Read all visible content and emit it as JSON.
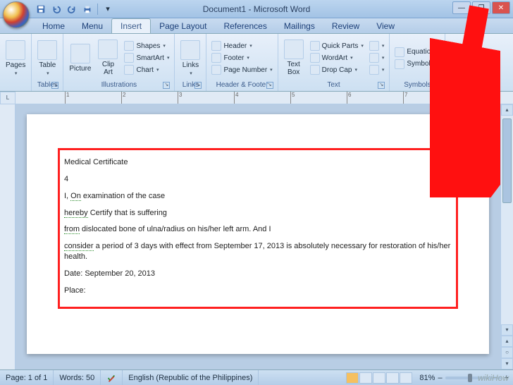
{
  "app": {
    "title": "Document1 - Microsoft Word"
  },
  "window_controls": {
    "minimize": "—",
    "maximize": "❐",
    "close": "✕"
  },
  "tabs": {
    "items": [
      "Home",
      "Menu",
      "Insert",
      "Page Layout",
      "References",
      "Mailings",
      "Review",
      "View"
    ],
    "active_index": 2
  },
  "ribbon": {
    "groups": [
      {
        "label": "",
        "large": [
          {
            "text": "Pages",
            "icon": "pages-icon"
          }
        ]
      },
      {
        "label": "Tables",
        "large": [
          {
            "text": "Table",
            "icon": "table-icon"
          }
        ]
      },
      {
        "label": "Illustrations",
        "large": [
          {
            "text": "Picture",
            "icon": "picture-icon"
          },
          {
            "text": "Clip\nArt",
            "icon": "clipart-icon"
          }
        ],
        "small": [
          {
            "text": "Shapes",
            "icon": "shapes-icon"
          },
          {
            "text": "SmartArt",
            "icon": "smartart-icon"
          },
          {
            "text": "Chart",
            "icon": "chart-icon"
          }
        ]
      },
      {
        "label": "Links",
        "large": [
          {
            "text": "Links",
            "icon": "links-icon"
          }
        ]
      },
      {
        "label": "Header & Footer",
        "small": [
          {
            "text": "Header",
            "icon": "header-icon"
          },
          {
            "text": "Footer",
            "icon": "footer-icon"
          },
          {
            "text": "Page Number",
            "icon": "pagenum-icon"
          }
        ]
      },
      {
        "label": "Text",
        "large": [
          {
            "text": "Text\nBox",
            "icon": "textbox-icon"
          }
        ],
        "small": [
          {
            "text": "Quick Parts",
            "icon": "quickparts-icon"
          },
          {
            "text": "WordArt",
            "icon": "wordart-icon"
          },
          {
            "text": "Drop Cap",
            "icon": "dropcap-icon"
          }
        ],
        "small2": [
          {
            "text": "",
            "icon": "sig-icon"
          },
          {
            "text": "",
            "icon": "date-icon"
          },
          {
            "text": "",
            "icon": "obj-icon"
          }
        ]
      },
      {
        "label": "Symbols",
        "small": [
          {
            "text": "Equation",
            "icon": "equation-icon"
          },
          {
            "text": "Symbol",
            "icon": "symbol-icon"
          }
        ]
      }
    ]
  },
  "document": {
    "lines": [
      "Medical Certificate",
      "4",
      {
        "pre": "I, ",
        "wavy": "On",
        "post": " examination of the case"
      },
      {
        "pre": "",
        "wavy": "hereby",
        "post": " Certify that is suffering"
      },
      {
        "pre": "",
        "wavy": "from",
        "post": " dislocated bone of ulna/radius on his/her left arm. And I"
      },
      {
        "pre": "",
        "wavy": "consider",
        "post": " a period of 3 days with effect from September 17, 2013 is absolutely necessary for restoration of his/her health."
      },
      "Date: September 20, 2013",
      "Place:"
    ]
  },
  "status": {
    "page": "Page: 1 of 1",
    "words": "Words: 50",
    "language": "English (Republic of the Philippines)",
    "zoom": "81%"
  },
  "ruler_marks": [
    "1",
    "2",
    "3",
    "4",
    "5",
    "6",
    "7"
  ],
  "watermark": "wikiHow"
}
